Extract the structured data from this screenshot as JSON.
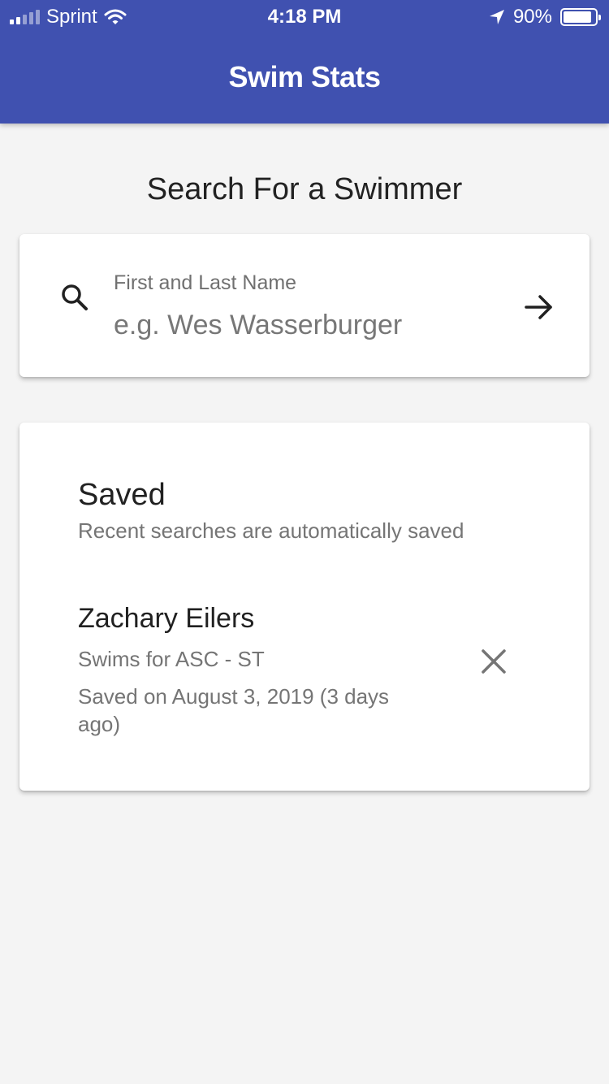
{
  "status_bar": {
    "carrier": "Sprint",
    "time": "4:18 PM",
    "battery_percent": "90%",
    "battery_level": 0.9,
    "signal_bars": 2
  },
  "app": {
    "title": "Swim Stats",
    "header_color": "#4051b0"
  },
  "search": {
    "heading": "Search For a Swimmer",
    "field_label": "First and Last Name",
    "placeholder": "e.g. Wes Wasserburger",
    "value": "",
    "icon": "search-icon",
    "submit_icon": "arrow-right-icon"
  },
  "saved": {
    "heading": "Saved",
    "subtitle": "Recent searches are automatically saved",
    "items": [
      {
        "name": "Zachary Eilers",
        "team": "Swims for ASC - ST",
        "saved_on": "Saved on August 3, 2019 (3 days ago)",
        "remove_icon": "close-icon"
      }
    ]
  }
}
